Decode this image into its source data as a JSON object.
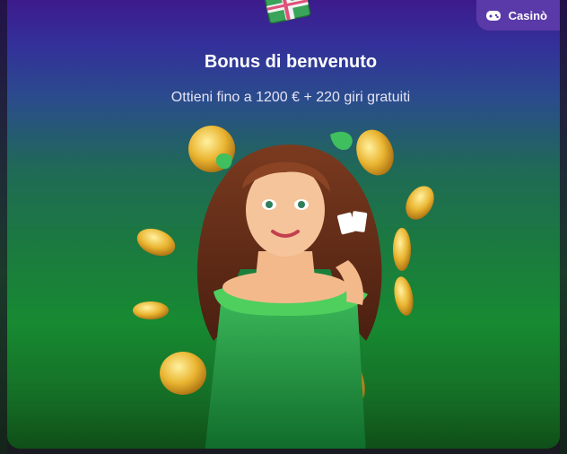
{
  "badge": {
    "label": "Casinò",
    "icon": "game-controller-icon"
  },
  "promo": {
    "title": "Bonus di benvenuto",
    "subtitle": "Ottieni fino a 1200 € + 220 giri gratuiti"
  },
  "illustration": {
    "description_icon": "casino-woman-coins-illustration",
    "gift_icon": "gift-box-icon"
  },
  "colors": {
    "top": "#3d1a8c",
    "middle": "#1f6a55",
    "bottom": "#0f4f18",
    "badge_bg": "#5a3aa8",
    "coin": "#e8b632"
  }
}
